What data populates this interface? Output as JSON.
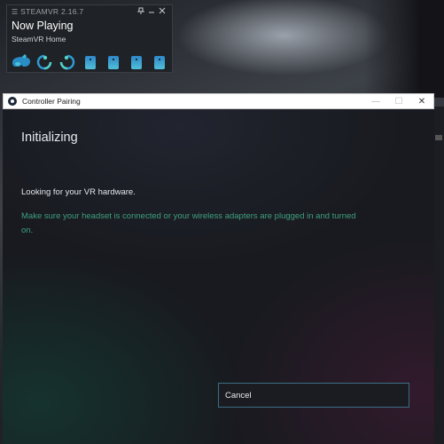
{
  "steamvr": {
    "title": "STEAMVR 2.16.7",
    "status": "Now Playing",
    "app": "SteamVR Home"
  },
  "dialog": {
    "title": "Controller Pairing",
    "heading": "Initializing",
    "message": "Looking for your VR hardware.",
    "hint": "Make sure your headset is connected or your wireless adapters are plugged in and turned on.",
    "cancel_label": "Cancel"
  }
}
